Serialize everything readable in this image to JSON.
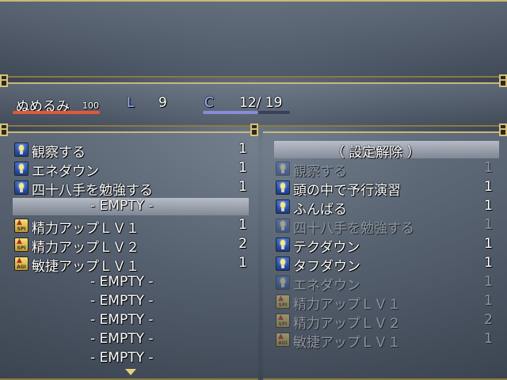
{
  "status": {
    "name": "ぬめるみ",
    "level_small": "100",
    "l_label": "L",
    "l_value": "9",
    "c_label": "C",
    "c_value": "12/ 19"
  },
  "left_list": [
    {
      "label": "観察する",
      "count": "1",
      "icon": "bulb-icon"
    },
    {
      "label": "エネダウン",
      "count": "1",
      "icon": "bulb-icon"
    },
    {
      "label": "四十八手を勉強する",
      "count": "1",
      "icon": "bulb-icon"
    },
    {
      "label": "-  EMPTY  -",
      "count": "",
      "icon": ""
    },
    {
      "label": "精力アップＬＶ１",
      "count": "1",
      "icon": "spi-up-icon"
    },
    {
      "label": "精力アップＬＶ２",
      "count": "2",
      "icon": "spi-up-icon"
    },
    {
      "label": "敏捷アップＬＶ１",
      "count": "1",
      "icon": "agi-up-icon"
    },
    {
      "label": "-  EMPTY  -",
      "count": "",
      "icon": ""
    },
    {
      "label": "-  EMPTY  -",
      "count": "",
      "icon": ""
    },
    {
      "label": "-  EMPTY  -",
      "count": "",
      "icon": ""
    },
    {
      "label": "-  EMPTY  -",
      "count": "",
      "icon": ""
    },
    {
      "label": "-  EMPTY  -",
      "count": "",
      "icon": ""
    }
  ],
  "right_header": "（ 設定解除 ）",
  "right_list": [
    {
      "label": "観察する",
      "count": "1",
      "dim": true
    },
    {
      "label": "頭の中で予行演習",
      "count": "1",
      "dim": false
    },
    {
      "label": "ふんばる",
      "count": "1",
      "dim": false
    },
    {
      "label": "四十八手を勉強する",
      "count": "1",
      "dim": true
    },
    {
      "label": "テクダウン",
      "count": "1",
      "dim": false
    },
    {
      "label": "タフダウン",
      "count": "1",
      "dim": false
    },
    {
      "label": "エネダウン",
      "count": "1",
      "dim": true
    },
    {
      "label": "精力アップＬＶ１",
      "count": "1",
      "dim": true
    },
    {
      "label": "精力アップＬＶ２",
      "count": "2",
      "dim": true
    },
    {
      "label": "敏捷アップＬＶ１",
      "count": "1",
      "dim": true
    }
  ],
  "icon_text": {
    "spi": "SPI",
    "agi": "AGI"
  },
  "colors": {
    "hp_bar": "#e05a3a",
    "c_bar": "#8a8ad8",
    "frame_gold": "#d6c07a"
  }
}
